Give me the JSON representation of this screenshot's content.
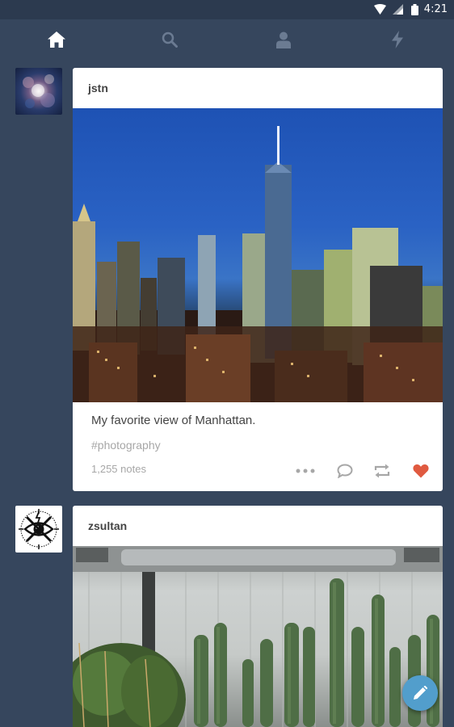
{
  "status_bar": {
    "time": "4:21",
    "icons": [
      "wifi-icon",
      "cell-signal-icon",
      "battery-icon"
    ]
  },
  "nav": {
    "tabs": [
      {
        "name": "home",
        "icon": "home-icon",
        "active": true
      },
      {
        "name": "search",
        "icon": "search-icon",
        "active": false
      },
      {
        "name": "account",
        "icon": "person-icon",
        "active": false
      },
      {
        "name": "activity",
        "icon": "lightning-icon",
        "active": false
      }
    ]
  },
  "posts": [
    {
      "username": "jstn",
      "avatar_icon": "nebula-avatar",
      "image": "manhattan-skyline-photo",
      "caption": "My favorite view of Manhattan.",
      "tag": "#photography",
      "notes": "1,255 notes",
      "actions": [
        "more-icon",
        "reply-icon",
        "reblog-icon",
        "like-icon"
      ],
      "liked": true
    },
    {
      "username": "zsultan",
      "avatar_icon": "eye-logo-avatar",
      "image": "cactus-plants-photo"
    }
  ],
  "colors": {
    "background": "#36465d",
    "status_bar": "#2c3a4f",
    "like": "#e05a40",
    "fab": "#529ecc"
  },
  "fab": {
    "icon": "pencil-icon"
  }
}
